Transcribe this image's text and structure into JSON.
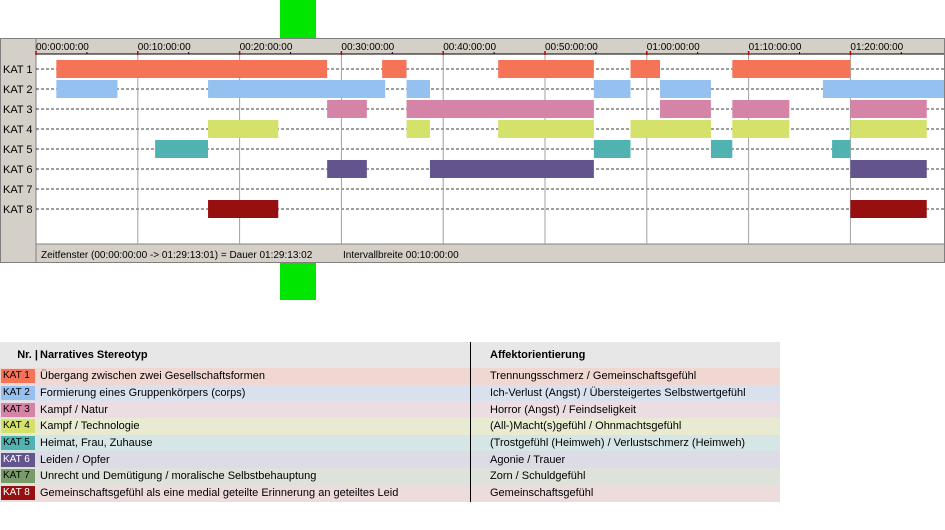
{
  "chart_data": {
    "type": "timeline",
    "x_unit": "minutes",
    "x_range": [
      0,
      89.2
    ],
    "tick_labels": [
      "00:00:00:00",
      "00:10:00:00",
      "00:20:00:00",
      "00:30:00:00",
      "00:40:00:00",
      "00:50:00:00",
      "01:00:00:00",
      "01:10:00:00",
      "01:20:00:00"
    ],
    "tick_values": [
      0,
      10,
      20,
      30,
      40,
      50,
      60,
      70,
      80
    ],
    "categories": [
      "KAT 1",
      "KAT 2",
      "KAT 3",
      "KAT 4",
      "KAT 5",
      "KAT 6",
      "KAT 7",
      "KAT 8"
    ],
    "colors": [
      "#f57356",
      "#94c1f0",
      "#d583a7",
      "#d4e16a",
      "#50b3b1",
      "#63548e",
      "#7a9a6a",
      "#961010"
    ],
    "series": [
      {
        "category": "KAT 1",
        "intervals": [
          [
            2,
            28.6
          ],
          [
            34,
            36.4
          ],
          [
            45.4,
            54.8
          ],
          [
            58.4,
            61.3
          ],
          [
            68.4,
            80
          ]
        ]
      },
      {
        "category": "KAT 2",
        "intervals": [
          [
            2,
            8
          ],
          [
            16.9,
            34.3
          ],
          [
            36.4,
            38.7
          ],
          [
            54.8,
            58.4
          ],
          [
            61.3,
            66.3
          ],
          [
            77.3,
            91.5
          ]
        ]
      },
      {
        "category": "KAT 3",
        "intervals": [
          [
            28.6,
            32.5
          ],
          [
            36.4,
            54.8
          ],
          [
            61.3,
            66.3
          ],
          [
            68.4,
            74
          ],
          [
            80,
            87.5
          ]
        ]
      },
      {
        "category": "KAT 4",
        "intervals": [
          [
            16.9,
            23.8
          ],
          [
            36.4,
            38.7
          ],
          [
            45.4,
            54.8
          ],
          [
            58.4,
            66.3
          ],
          [
            68.4,
            74
          ],
          [
            80,
            87.5
          ]
        ]
      },
      {
        "category": "KAT 5",
        "intervals": [
          [
            11.7,
            16.9
          ],
          [
            54.8,
            58.4
          ],
          [
            66.3,
            68.4
          ],
          [
            78.2,
            80
          ]
        ]
      },
      {
        "category": "KAT 6",
        "intervals": [
          [
            28.6,
            32.5
          ],
          [
            38.7,
            54.8
          ],
          [
            80,
            87.5
          ]
        ]
      },
      {
        "category": "KAT 7",
        "intervals": []
      },
      {
        "category": "KAT 8",
        "intervals": [
          [
            16.9,
            23.8
          ],
          [
            80,
            87.5
          ]
        ]
      }
    ]
  },
  "status_bar": {
    "text": "Zeitfenster (00:00:00:00 -> 01:29:13:01) = Dauer 01:29:13:02",
    "interval": "Intervallbreite 00:10:00:00"
  },
  "legend": {
    "header": {
      "nr": "Nr. |",
      "stereotyp": "Narratives Stereotyp",
      "affekt": "Affektorientierung"
    },
    "rows": [
      {
        "nr": "KAT 1",
        "stereotyp": "Übergang zwischen zwei Gesellschaftsformen",
        "affekt": "Trennungsschmerz / Gemeinschaftsgefühl",
        "color": "#f57356",
        "bg": "#f0d7d2"
      },
      {
        "nr": "KAT 2",
        "stereotyp": "Formierung eines Gruppenkörpers (corps)",
        "affekt": "Ich-Verlust (Angst) / Übersteigertes Selbstwertgefühl",
        "color": "#94c1f0",
        "bg": "#dae1ee"
      },
      {
        "nr": "KAT 3",
        "stereotyp": "Kampf / Natur",
        "affekt": "Horror (Angst) / Feindseligkeit",
        "color": "#d583a7",
        "bg": "#ecdde3"
      },
      {
        "nr": "KAT 4",
        "stereotyp": "Kampf / Technologie",
        "affekt": "(All-)Macht(s)gefühl / Ohnmachtsgefühl",
        "color": "#d4e16a",
        "bg": "#e8ebd2"
      },
      {
        "nr": "KAT 5",
        "stereotyp": "Heimat, Frau, Zuhause",
        "affekt": "(Trostgefühl (Heimweh) / Verlustschmerz (Heimweh)",
        "color": "#50b3b1",
        "bg": "#d5e6e5"
      },
      {
        "nr": "KAT 6",
        "stereotyp": "Leiden / Opfer",
        "affekt": "Agonie / Trauer",
        "color": "#63548e",
        "bg": "#dddbe6"
      },
      {
        "nr": "KAT 7",
        "stereotyp": "Unrecht und Demütigung / moralische Selbstbehauptung",
        "affekt": "Zorn / Schuldgefühl",
        "color": "#7a9a6a",
        "bg": "#dde2da"
      },
      {
        "nr": "KAT 8",
        "stereotyp": "Gemeinschaftsgefühl als eine medial geteilte Erinnerung an geteiltes Leid",
        "affekt": "Gemeinschaftsgefühl",
        "color": "#961010",
        "bg": "#ecdcdc"
      }
    ]
  }
}
